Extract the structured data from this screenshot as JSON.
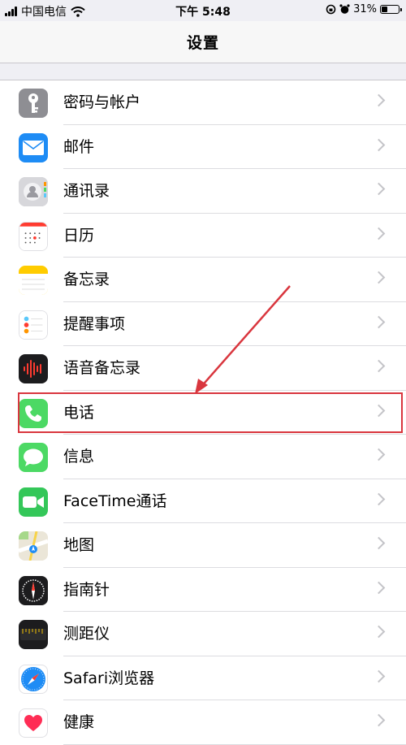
{
  "status_bar": {
    "carrier": "中国电信",
    "time": "下午 5:48",
    "battery_text": "31%",
    "battery_level": 0.31
  },
  "nav": {
    "title": "设置"
  },
  "items": [
    {
      "label": "密码与帐户",
      "icon": "key-icon",
      "color": "#8e8e93"
    },
    {
      "label": "邮件",
      "icon": "mail-icon",
      "color": "#1e8cf5"
    },
    {
      "label": "通讯录",
      "icon": "contacts-icon",
      "color": "#cfcfd3"
    },
    {
      "label": "日历",
      "icon": "calendar-icon",
      "color": "#ffffff"
    },
    {
      "label": "备忘录",
      "icon": "notes-icon",
      "color": "#ffcc00"
    },
    {
      "label": "提醒事项",
      "icon": "reminders-icon",
      "color": "#ffffff"
    },
    {
      "label": "语音备忘录",
      "icon": "voice-memos-icon",
      "color": "#1c1c1e"
    },
    {
      "label": "电话",
      "icon": "phone-icon",
      "color": "#4cd964"
    },
    {
      "label": "信息",
      "icon": "messages-icon",
      "color": "#4cd964"
    },
    {
      "label": "FaceTime通话",
      "icon": "facetime-icon",
      "color": "#34c759"
    },
    {
      "label": "地图",
      "icon": "maps-icon",
      "color": "#e8e3d7"
    },
    {
      "label": "指南针",
      "icon": "compass-icon",
      "color": "#1c1c1e"
    },
    {
      "label": "测距仪",
      "icon": "measure-icon",
      "color": "#1c1c1e"
    },
    {
      "label": "Safari浏览器",
      "icon": "safari-icon",
      "color": "#ffffff"
    },
    {
      "label": "健康",
      "icon": "health-icon",
      "color": "#ffffff"
    }
  ],
  "highlight_color": "#d9363e"
}
